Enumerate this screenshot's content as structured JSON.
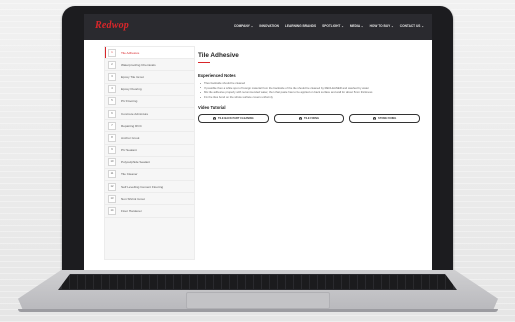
{
  "header": {
    "logo": "Redwop",
    "nav": [
      "COMPANY ⌄",
      "INNOVATION",
      "LEARNING BRANDS",
      "SPOTLIGHT ⌄",
      "MEDIA ⌄",
      "HOW TO BUY ⌄",
      "CONTACT US ⌄"
    ]
  },
  "sidebar": {
    "items": [
      {
        "num": "1",
        "label": "Tile Adhesive"
      },
      {
        "num": "2",
        "label": "Waterproofing Chemicals"
      },
      {
        "num": "3",
        "label": "Epoxy Tile Grout"
      },
      {
        "num": "4",
        "label": "Epoxy Flooring"
      },
      {
        "num": "5",
        "label": "PU Flooring"
      },
      {
        "num": "6",
        "label": "Concrete Admixture"
      },
      {
        "num": "7",
        "label": "Repairing RCC"
      },
      {
        "num": "8",
        "label": "Anchor Grout"
      },
      {
        "num": "9",
        "label": "PU Sealant"
      },
      {
        "num": "10",
        "label": "Polysulphide Sealant"
      },
      {
        "num": "11",
        "label": "Tile Cleaner"
      },
      {
        "num": "12",
        "label": "Self Levelling Cement Flooring"
      },
      {
        "num": "13",
        "label": "Non Shrink Grout"
      },
      {
        "num": "14",
        "label": "Floor Hardener"
      }
    ]
  },
  "content": {
    "title": "Tile Adhesive",
    "notes_heading": "Experienced Notes",
    "notes": [
      "Tiles backside should be cleaned",
      "If possible then a white spot of foreign material from the backside of the tile should be cleaned by RECLEANER and washed by water",
      "Mix tile adhesive properly with recommended water, then that paste has to be applied on back surface and wall for about 5mm thickness",
      "Fix the tiles bond on the whole surface covers uniformly"
    ],
    "video_heading": "Video Tutorial",
    "video_buttons": [
      "TILE BACK PART CLEANING",
      "TILE FIXING",
      "STONE FIXING"
    ]
  },
  "colors": {
    "accent": "#d8262a",
    "topbar": "#2a2a2f"
  }
}
